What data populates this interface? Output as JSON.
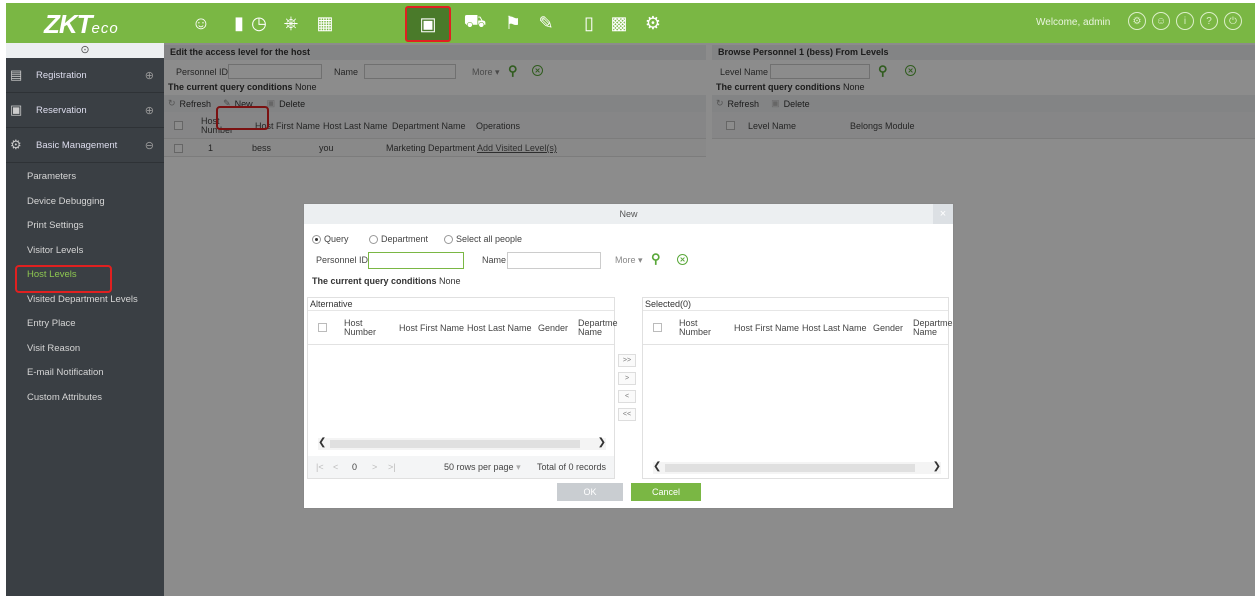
{
  "app": {
    "logo_main": "ZKT",
    "logo_sub": "eco",
    "welcome": "Welcome, admin",
    "top_icons": [
      "person-icon",
      "door-icon",
      "clock-icon",
      "elevator-icon",
      "barcode-icon",
      "visitor-icon",
      "car-icon",
      "patrol-icon",
      "card-icon",
      "phone-icon",
      "camera-icon",
      "settings-icon"
    ],
    "accent": "#7ab744"
  },
  "sidebar": {
    "collapse_glyph": "⊙",
    "sections": [
      {
        "label": "Registration",
        "icon": "document-icon"
      },
      {
        "label": "Reservation",
        "icon": "monitor-icon"
      },
      {
        "label": "Basic Management",
        "icon": "gears-icon"
      }
    ],
    "items": [
      "Parameters",
      "Device Debugging",
      "Print Settings",
      "Visitor Levels",
      "Host Levels",
      "Visited Department Levels",
      "Entry Place",
      "Visit Reason",
      "E-mail Notification",
      "Custom Attributes"
    ]
  },
  "left_panel": {
    "title": "Edit the access level for the host",
    "personnel_label": "Personnel ID",
    "name_label": "Name",
    "more": "More",
    "cond_label": "The current query conditions",
    "cond_value": "None",
    "refresh": "Refresh",
    "new": "New",
    "delete": "Delete",
    "columns": [
      "Host Number",
      "Host First Name",
      "Host Last Name",
      "Department Name",
      "Operations"
    ],
    "rows": [
      {
        "num": "1",
        "first": "bess",
        "last": "you",
        "dept": "Marketing Department",
        "op": "Add Visited Level(s)"
      }
    ]
  },
  "right_panel": {
    "title": "Browse Personnel 1 (bess) From Levels",
    "level_label": "Level Name",
    "cond_label": "The current query conditions",
    "cond_value": "None",
    "refresh": "Refresh",
    "delete": "Delete",
    "columns": [
      "Level Name",
      "Belongs Module"
    ]
  },
  "dialog": {
    "title": "New",
    "close": "×",
    "radio_query": "Query",
    "radio_department": "Department",
    "radio_all": "Select all people",
    "personnel_label": "Personnel ID",
    "name_label": "Name",
    "more": "More",
    "cond_label": "The current query conditions",
    "cond_value": "None",
    "alt_title": "Alternative",
    "sel_title": "Selected(0)",
    "columns": [
      "Host Number",
      "Host First Name",
      "Host Last Name",
      "Gender",
      "Departme Name"
    ],
    "move_buttons": [
      ">>",
      ">",
      "<",
      "<<"
    ],
    "pager_page": "0",
    "pager_rows": "50 rows per page",
    "pager_total": "Total of 0 records",
    "ok": "OK",
    "cancel": "Cancel"
  }
}
